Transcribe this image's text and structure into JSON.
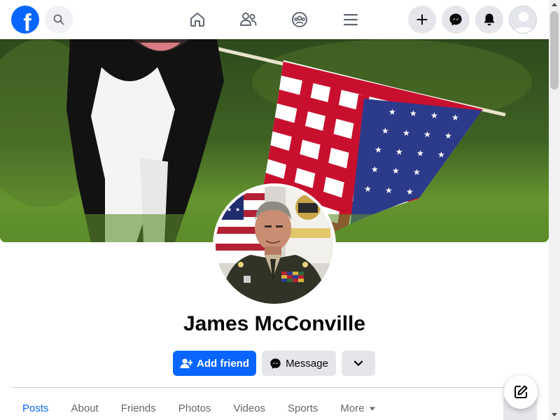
{
  "profile": {
    "name": "James McConville"
  },
  "actions": {
    "add_friend": "Add friend",
    "message": "Message"
  },
  "tabs": [
    {
      "label": "Posts",
      "active": true
    },
    {
      "label": "About"
    },
    {
      "label": "Friends"
    },
    {
      "label": "Photos"
    },
    {
      "label": "Videos"
    },
    {
      "label": "Sports"
    },
    {
      "label": "More"
    }
  ],
  "icons": {
    "logo": "facebook-logo",
    "search": "search-icon",
    "nav": [
      "home-icon",
      "friends-icon",
      "groups-icon",
      "menu-icon"
    ],
    "right": [
      "plus-icon",
      "messenger-icon",
      "bell-icon",
      "avatar"
    ],
    "fab": "compose-icon"
  },
  "colors": {
    "brand": "#0866ff",
    "button_gray": "#e4e6eb",
    "text": "#050505",
    "muted": "#65676b"
  }
}
